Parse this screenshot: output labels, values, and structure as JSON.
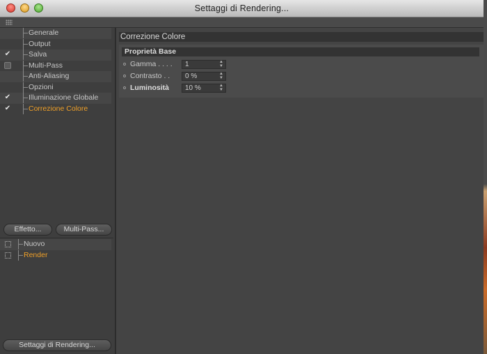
{
  "window": {
    "title": "Settaggi di Rendering..."
  },
  "tree": [
    {
      "label": "Generale",
      "check": "none",
      "active": false
    },
    {
      "label": "Output",
      "check": "none",
      "active": false
    },
    {
      "label": "Salva",
      "check": "checked",
      "active": false
    },
    {
      "label": "Multi-Pass",
      "check": "box",
      "active": false
    },
    {
      "label": "Anti-Aliasing",
      "check": "none",
      "active": false
    },
    {
      "label": "Opzioni",
      "check": "none",
      "active": false
    },
    {
      "label": "Illuminazione Globale",
      "check": "checked",
      "active": false
    },
    {
      "label": "Correzione Colore",
      "check": "checked",
      "active": true
    }
  ],
  "buttons": {
    "effetto": "Effetto...",
    "multipass": "Multi-Pass...",
    "settings": "Settaggi di Rendering..."
  },
  "settings_list": [
    {
      "label": "Nuovo",
      "active": false
    },
    {
      "label": "Render",
      "active": true
    }
  ],
  "panel": {
    "title": "Correzione Colore",
    "group_title": "Proprietà Base",
    "props": [
      {
        "label": "Gamma . . . .",
        "value": "1",
        "bold": false
      },
      {
        "label": "Contrasto . .",
        "value": "0 %",
        "bold": false
      },
      {
        "label": "Luminosità",
        "value": "10 %",
        "bold": true
      }
    ]
  },
  "icons": {
    "check": "checkmark-icon",
    "spinner": "spinner-arrows-icon",
    "grip": "grip-icon"
  }
}
